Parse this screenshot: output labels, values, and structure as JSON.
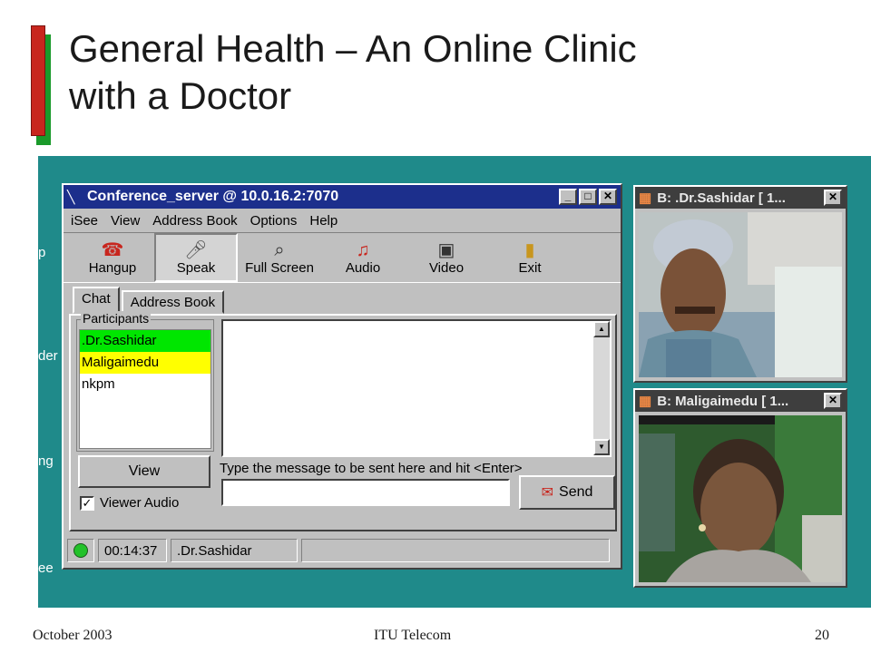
{
  "slide": {
    "title_line1": "General Health – An Online Clinic",
    "title_line2": "with a Doctor",
    "footer_left": "October 2003",
    "footer_center": "ITU Telecom",
    "footer_right": "20"
  },
  "desktop": {
    "fragments": [
      "p",
      "der",
      "ng",
      "ee"
    ]
  },
  "window": {
    "title": "Conference_server @ 10.0.16.2:7070",
    "menu": [
      "iSee",
      "View",
      "Address Book",
      "Options",
      "Help"
    ],
    "toolbar": [
      {
        "label": "Hangup",
        "icon": "phone-icon"
      },
      {
        "label": "Speak",
        "icon": "microphone-icon",
        "pressed": true
      },
      {
        "label": "Full Screen",
        "icon": "magnifier-icon"
      },
      {
        "label": "Audio",
        "icon": "speaker-icon"
      },
      {
        "label": "Video",
        "icon": "camera-icon"
      },
      {
        "label": "Exit",
        "icon": "door-icon"
      }
    ],
    "tabs": [
      "Chat",
      "Address Book"
    ],
    "participants_label": "Participants",
    "participants": [
      {
        "name": ".Dr.Sashidar",
        "color": "#00e600"
      },
      {
        "name": "Maligaimedu",
        "color": "#ffff00"
      },
      {
        "name": "nkpm",
        "color": "#ffffff"
      }
    ],
    "view_button": "View",
    "viewer_audio_label": "Viewer Audio",
    "viewer_audio_checked": "✓",
    "message_hint": "Type the message to be sent here and hit <Enter>",
    "message_value": "",
    "send_button": "Send",
    "status": {
      "time": "00:14:37",
      "user": ".Dr.Sashidar"
    }
  },
  "videos": [
    {
      "title": "B: .Dr.Sashidar [ 1..."
    },
    {
      "title": "B: Maligaimedu [ 1..."
    }
  ],
  "colors": {
    "title_bar": "#1c2f8c",
    "desktop": "#1f8a8a",
    "accent_red": "#c8261e",
    "accent_green": "#1a9a2a"
  }
}
